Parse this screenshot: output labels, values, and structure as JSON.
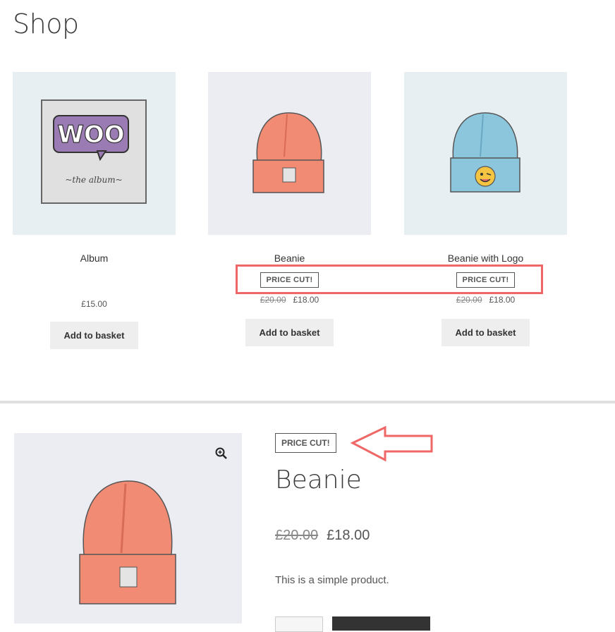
{
  "page": {
    "title": "Shop"
  },
  "products": [
    {
      "name": "Album",
      "badge": "",
      "old_price": "",
      "price": "£15.00",
      "button": "Add to basket"
    },
    {
      "name": "Beanie",
      "badge": "PRICE CUT!",
      "old_price": "£20.00",
      "price": "£18.00",
      "button": "Add to basket"
    },
    {
      "name": "Beanie with Logo",
      "badge": "PRICE CUT!",
      "old_price": "£20.00",
      "price": "£18.00",
      "button": "Add to basket"
    }
  ],
  "album_art": {
    "logo_text": "WOO",
    "subtitle": "~the album~"
  },
  "detail": {
    "badge": "PRICE CUT!",
    "title": "Beanie",
    "old_price": "£20.00",
    "price": "£18.00",
    "description": "This is a simple product.",
    "zoom_icon": "zoom-icon"
  },
  "colors": {
    "annotation": "#ef6767",
    "beanie": "#f28b74",
    "beanie_logo": "#8cc6dd",
    "album_purple": "#9b7bb4"
  }
}
